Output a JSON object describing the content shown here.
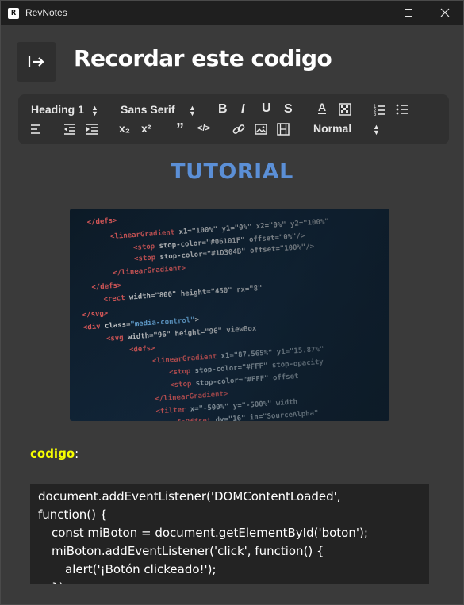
{
  "window": {
    "title": "RevNotes",
    "icon_letter": "R"
  },
  "page": {
    "title": "Recordar este codigo",
    "back_icon": "exit-arrow-icon"
  },
  "toolbar": {
    "heading_select": "Heading 1",
    "font_select": "Sans Serif",
    "size_select": "Normal",
    "bold": "B",
    "italic": "I",
    "underline": "U",
    "strike": "S",
    "text_color": "A",
    "subscript": "x₂",
    "superscript": "x²",
    "quote": "”",
    "code": "</>"
  },
  "content": {
    "heading": "TUTORIAL",
    "label": "codigo",
    "label_suffix": ":",
    "code_lines": [
      "document.addEventListener('DOMContentLoaded',",
      "function() {",
      "const miBoton = document.getElementById('boton');",
      "miBoton.addEventListener('click', function() {",
      "alert('¡Botón clickeado!');",
      "});"
    ]
  },
  "colors": {
    "heading": "#5b8fd6",
    "label": "#f7ff00",
    "code_bg": "#232323"
  }
}
